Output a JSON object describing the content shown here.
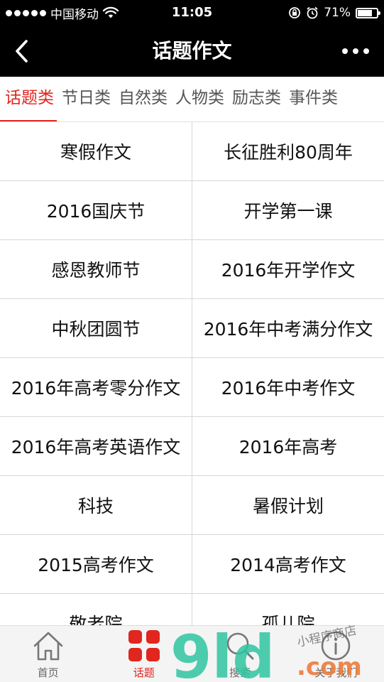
{
  "status_bar": {
    "carrier": "中国移动",
    "time": "11:05",
    "battery": "71%",
    "battery_level": 0.71
  },
  "nav": {
    "title": "话题作文"
  },
  "tabs": [
    {
      "label": "话题类",
      "active": true
    },
    {
      "label": "节日类",
      "active": false
    },
    {
      "label": "自然类",
      "active": false
    },
    {
      "label": "人物类",
      "active": false
    },
    {
      "label": "励志类",
      "active": false
    },
    {
      "label": "事件类",
      "active": false
    }
  ],
  "topics": [
    [
      "寒假作文",
      "长征胜利80周年"
    ],
    [
      "2016国庆节",
      "开学第一课"
    ],
    [
      "感恩教师节",
      "2016年开学作文"
    ],
    [
      "中秋团圆节",
      "2016年中考满分作文"
    ],
    [
      "2016年高考零分作文",
      "2016年中考作文"
    ],
    [
      "2016年高考英语作文",
      "2016年高考"
    ],
    [
      "科技",
      "暑假计划"
    ],
    [
      "2015高考作文",
      "2014高考作文"
    ],
    [
      "敬老院",
      "孤儿院"
    ]
  ],
  "tab_bar": [
    {
      "label": "首页",
      "icon": "home-icon",
      "active": false
    },
    {
      "label": "话题",
      "icon": "grid-icon",
      "active": true
    },
    {
      "label": "搜索",
      "icon": "search-icon",
      "active": false
    },
    {
      "label": "关于我们",
      "icon": "info-icon",
      "active": false
    }
  ],
  "watermark": {
    "brand": "9ld",
    "suffix": ".com",
    "tagline": "小程序商店"
  },
  "colors": {
    "accent": "#e0261e",
    "header_bg": "#000000",
    "tab_bar_bg": "#f4f4f4",
    "watermark_green": "#2ec4a0"
  }
}
